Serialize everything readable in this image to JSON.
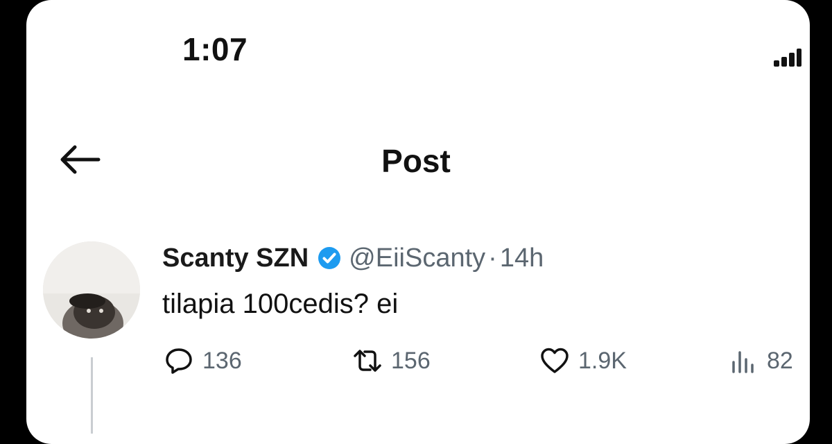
{
  "status_bar": {
    "time": "1:07"
  },
  "header": {
    "title": "Post"
  },
  "post": {
    "display_name": "Scanty SZN",
    "handle": "@EiiScanty",
    "separator": "·",
    "time_ago": "14h",
    "text": "tilapia 100cedis? ei",
    "replies": "136",
    "reposts": "156",
    "likes": "1.9K",
    "views": "82"
  },
  "colors": {
    "verified": "#1d9bf0",
    "muted": "#5b6670",
    "thread_line": "#c9cdd1"
  }
}
